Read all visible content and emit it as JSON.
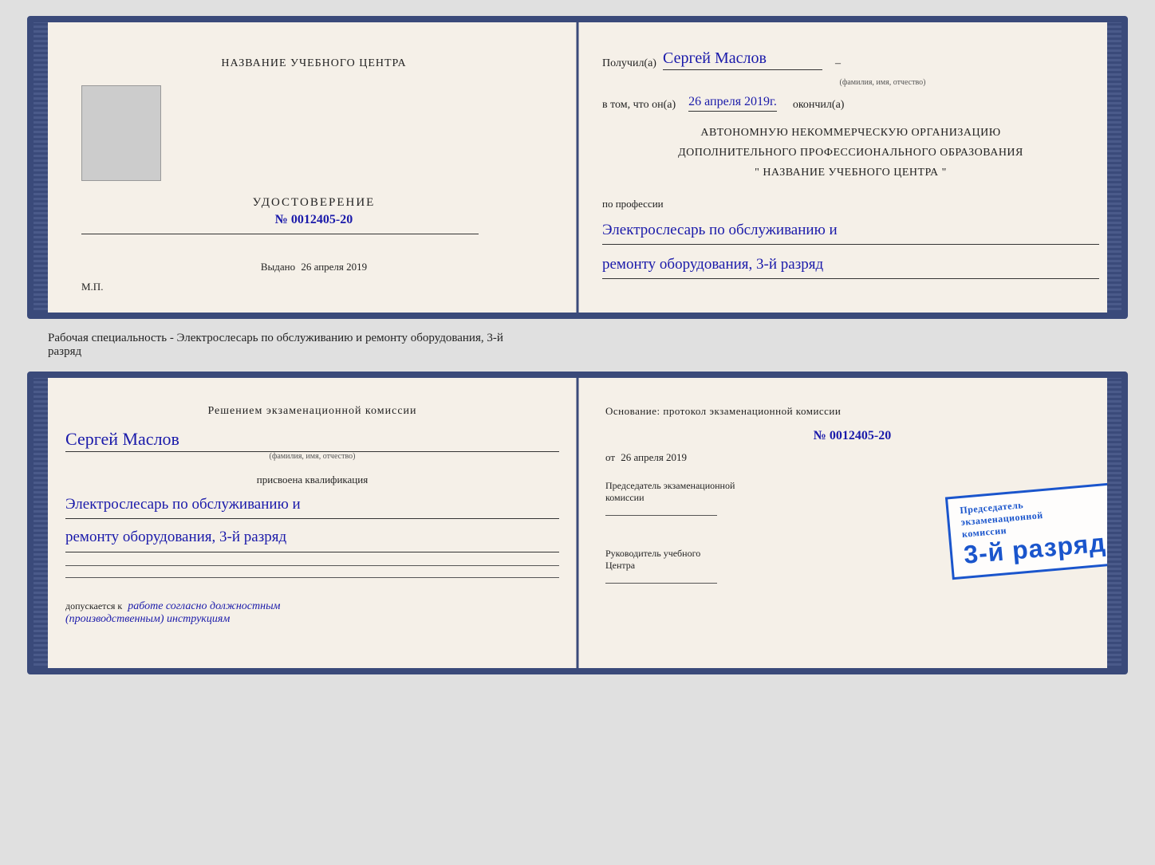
{
  "top_document": {
    "left": {
      "center_title": "НАЗВАНИЕ УЧЕБНОГО ЦЕНТРА",
      "udostoverenie_label": "УДОСТОВЕРЕНИЕ",
      "number_prefix": "№",
      "number": "0012405-20",
      "vydano_label": "Выдано",
      "vydano_date": "26 апреля 2019",
      "mp_label": "М.П."
    },
    "right": {
      "poluchil_label": "Получил(а)",
      "name_handwritten": "Сергей Маслов",
      "name_hint": "(фамилия, имя, отчество)",
      "dash": "–",
      "vtom_label": "в том, что он(а)",
      "date_handwritten": "26 апреля 2019г.",
      "okonchil_label": "окончил(а)",
      "org_line1": "АВТОНОМНУЮ НЕКОММЕРЧЕСКУЮ ОРГАНИЗАЦИЮ",
      "org_line2": "ДОПОЛНИТЕЛЬНОГО ПРОФЕССИОНАЛЬНОГО ОБРАЗОВАНИЯ",
      "org_line3": "\"   НАЗВАНИЕ УЧЕБНОГО ЦЕНТРА   \"",
      "po_professii_label": "по профессии",
      "profession_line1": "Электрослесарь по обслуживанию и",
      "profession_line2": "ремонту оборудования, 3-й разряд"
    }
  },
  "between_label": "Рабочая специальность - Электрослесарь по обслуживанию и ремонту оборудования, 3-й\nразряд",
  "bottom_document": {
    "left": {
      "resheniem_label": "Решением  экзаменационной  комиссии",
      "name_handwritten": "Сергей Маслов",
      "name_hint": "(фамилия, имя, отчество)",
      "prisvoena_label": "присвоена квалификация",
      "profession_line1": "Электрослесарь по обслуживанию и",
      "profession_line2": "ремонту оборудования, 3-й разряд",
      "dopuskaetsya_label": "допускается к",
      "dopuskaetsya_text": "работе согласно должностным\n(производственным) инструкциям"
    },
    "right": {
      "osnovanie_label": "Основание:  протокол  экзаменационной  комиссии",
      "number_prefix": "№",
      "number": "0012405-20",
      "ot_label": "от",
      "ot_date": "26 апреля 2019",
      "predsedatel_label": "Председатель экзаменационной\nкомиссии",
      "rukovoditel_label": "Руководитель учебного\nЦентра"
    },
    "stamp": {
      "line1": "Председатель экзаменационной",
      "line2": "комиссии",
      "large_text": "3-й разряд"
    }
  }
}
